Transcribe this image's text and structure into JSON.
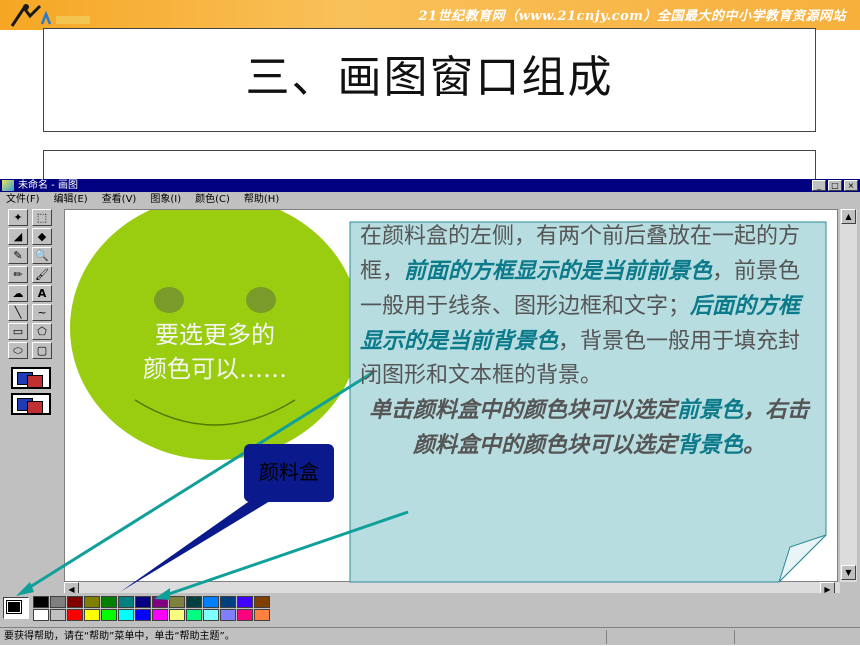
{
  "banner": {
    "slogan": "21世纪教育网（www.21cnjy.com）全国最大的中小学教育资源网站"
  },
  "slide": {
    "title": "三、画图窗口组成"
  },
  "window": {
    "title": "未命名 - 画图",
    "controls": {
      "min": "_",
      "max": "□",
      "close": "×"
    },
    "menu": [
      "文件(F)",
      "编辑(E)",
      "查看(V)",
      "图象(I)",
      "颜色(C)",
      "帮助(H)"
    ],
    "status_text": "要获得帮助，请在“帮助”菜单中，单击“帮助主题”。"
  },
  "tools": [
    "✦",
    "⬚",
    "◢",
    "◆",
    "✎",
    "🔍",
    "✏",
    "🖌",
    "☁",
    "A",
    "╲",
    "~",
    "▭",
    "⬠",
    "⬭",
    "▢"
  ],
  "palette": {
    "row1": [
      "#000000",
      "#808080",
      "#800000",
      "#808000",
      "#008000",
      "#008080",
      "#000080",
      "#800080",
      "#808040",
      "#004040",
      "#0080ff",
      "#004080",
      "#4000ff",
      "#804000"
    ],
    "row2": [
      "#ffffff",
      "#c0c0c0",
      "#ff0000",
      "#ffff00",
      "#00ff00",
      "#00ffff",
      "#0000ff",
      "#ff00ff",
      "#ffff80",
      "#00ff80",
      "#80ffff",
      "#8080ff",
      "#ff0080",
      "#ff8040"
    ]
  },
  "annotations": {
    "face_line1": "要选更多的",
    "face_line2": "颜色可以……",
    "palette_box": "颜料盒",
    "callout": {
      "p1a": "在颜料盒的左侧，有两个前后叠放在一起的方框，",
      "p1b": "前面的方框显示的是当前前景色",
      "p1c": "，前景色一般用于线条、图形边框和文字；",
      "p1d": "后面的方框显示的是当前背景色",
      "p1e": "，背景色一般用于填充封闭图形和文本框的背景。",
      "p2a": "单击颜料盒中的颜色块可以选定",
      "p2b": "前景色",
      "p2c": "，右击颜料盒中的颜色块可以选定",
      "p2d": "背景色",
      "p2e": "。"
    }
  },
  "colors": {
    "accent": "#0b7a8a",
    "callout_bg": "#b8dde0",
    "face": "#9acd10",
    "titlebar": "#000080"
  }
}
